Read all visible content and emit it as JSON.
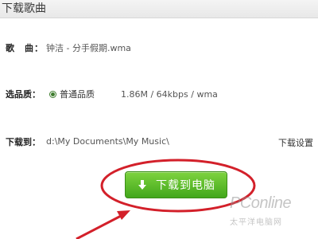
{
  "dialog": {
    "title": "下载歌曲"
  },
  "song": {
    "label": "歌　曲：",
    "value": "钟洁 - 分手假期.wma"
  },
  "quality": {
    "label": "选品质：",
    "option": "普通品质",
    "info": "1.86M / 64kbps / wma"
  },
  "destination": {
    "label": "下载到：",
    "path": "d:\\My Documents\\My Music\\",
    "settings_link": "下载设置"
  },
  "download_button": {
    "label": "下载到电脑",
    "icon": "download-arrow-icon"
  },
  "watermark": {
    "brand": "PConline",
    "sub": "太平洋电脑网"
  },
  "colors": {
    "button_top": "#7ed33f",
    "button_bottom": "#42a71b",
    "annotation_red": "#d3202a",
    "radio_green": "#3f7d2f"
  }
}
